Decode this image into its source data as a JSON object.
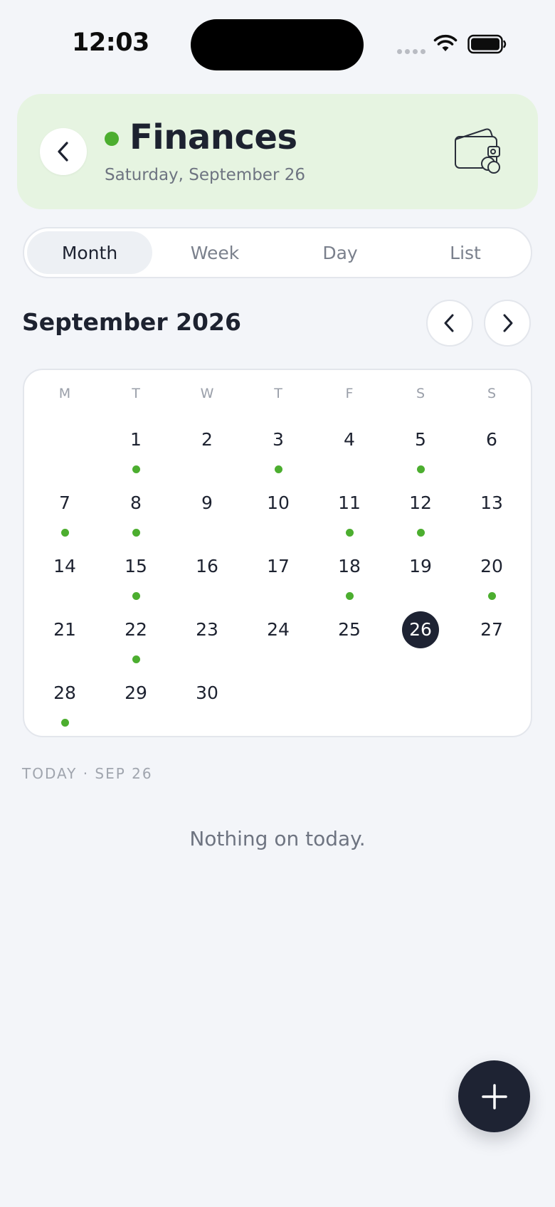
{
  "status_bar": {
    "time": "12:03",
    "icons": [
      "signal-dots-icon",
      "wifi-icon",
      "battery-icon"
    ]
  },
  "header": {
    "title": "Finances",
    "subtitle": "Saturday, September 26",
    "status_color": "#4cae2f",
    "background_color": "#e6f4e1",
    "icon": "wallet-icon"
  },
  "view_tabs": [
    {
      "label": "Month",
      "active": true
    },
    {
      "label": "Week",
      "active": false
    },
    {
      "label": "Day",
      "active": false
    },
    {
      "label": "List",
      "active": false
    }
  ],
  "calendar": {
    "month_title": "September 2026",
    "weekdays": [
      "M",
      "T",
      "W",
      "T",
      "F",
      "S",
      "S"
    ],
    "first_weekday_offset": 1,
    "days_in_month": 30,
    "today": 26,
    "event_days": [
      1,
      3,
      5,
      7,
      8,
      11,
      12,
      15,
      18,
      20,
      22,
      28
    ],
    "event_dot_color": "#4cae2f",
    "today_color": "#1e2333"
  },
  "today_section": {
    "label": "TODAY · SEP 26",
    "empty_message": "Nothing on today."
  },
  "fab": {
    "icon": "plus-icon"
  }
}
